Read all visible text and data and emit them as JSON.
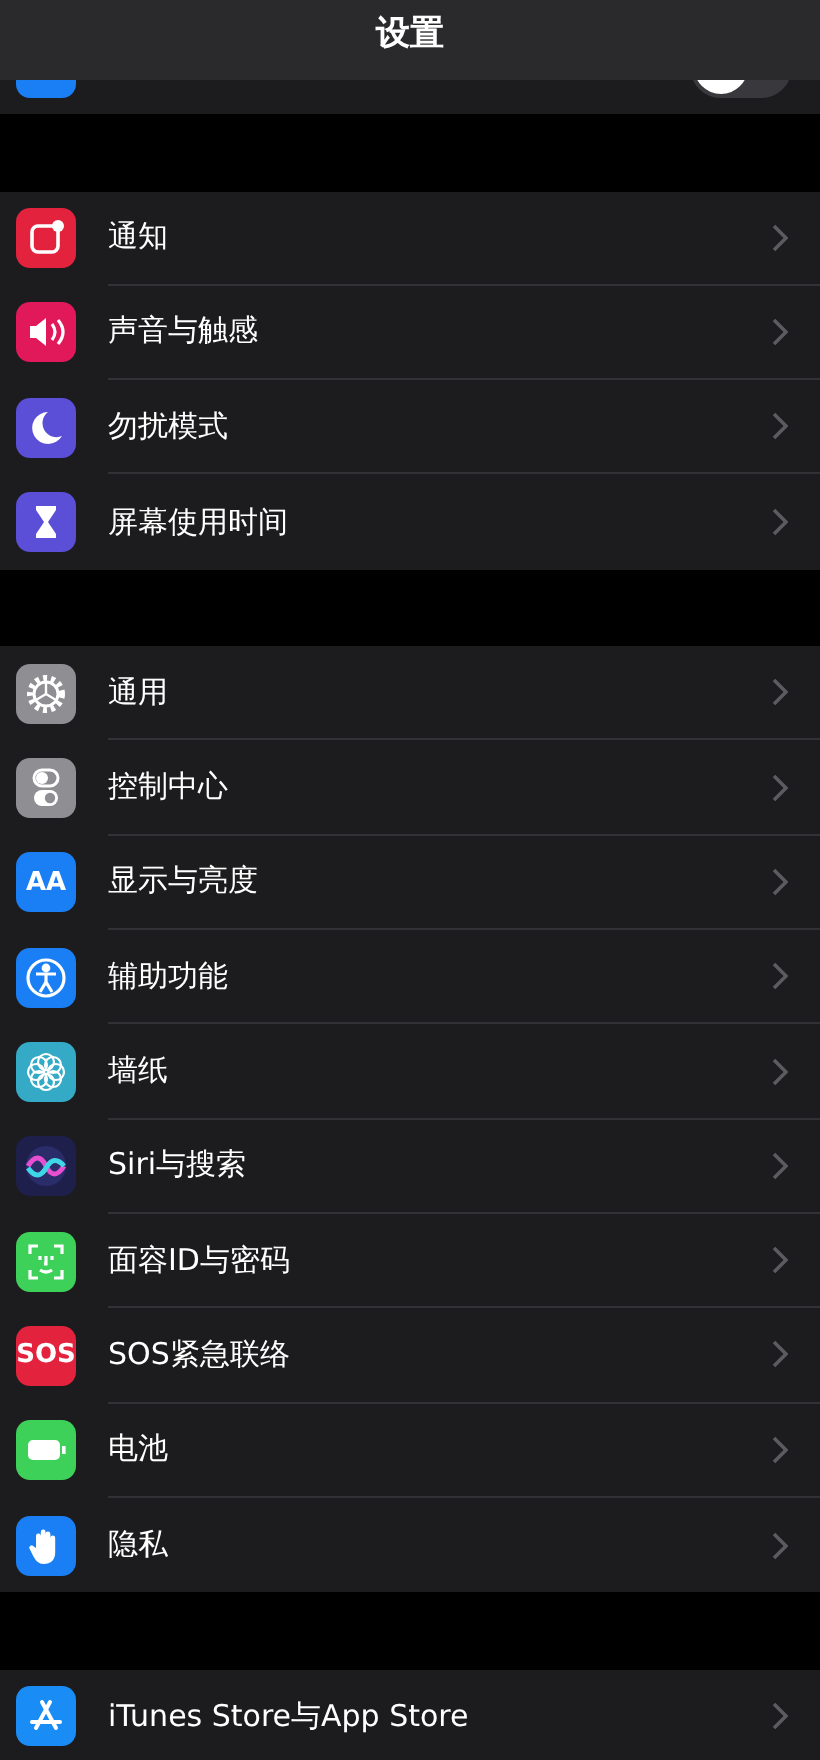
{
  "header": {
    "title": "设置"
  },
  "partial_row": {
    "color": "#1a7ff5",
    "toggle": {
      "on": false
    }
  },
  "sections": [
    {
      "rows": [
        {
          "label": "通知",
          "kind": "notification",
          "color": "#e3223d"
        },
        {
          "label": "声音与触感",
          "kind": "sound",
          "color": "#e1195a"
        },
        {
          "label": "勿扰模式",
          "kind": "moon",
          "color": "#5a4fd6"
        },
        {
          "label": "屏幕使用时间",
          "kind": "hourglass",
          "color": "#5a4fd6"
        }
      ]
    },
    {
      "rows": [
        {
          "label": "通用",
          "kind": "gear",
          "color": "#8e8e93"
        },
        {
          "label": "控制中心",
          "kind": "switches",
          "color": "#8e8e93"
        },
        {
          "label": "显示与亮度",
          "kind": "text",
          "icon_text": "AA",
          "color": "#1a7ff5"
        },
        {
          "label": "辅助功能",
          "kind": "accessibility",
          "color": "#1a7ff5"
        },
        {
          "label": "墙纸",
          "kind": "flower",
          "color": "#35aac6"
        },
        {
          "label": "Siri与搜索",
          "kind": "siri",
          "color": "#1e1f4a"
        },
        {
          "label": "面容ID与密码",
          "kind": "face",
          "color": "#3ed159"
        },
        {
          "label": "SOS紧急联络",
          "kind": "text",
          "icon_text": "SOS",
          "color": "#e3223d"
        },
        {
          "label": "电池",
          "kind": "battery",
          "color": "#3ed159"
        },
        {
          "label": "隐私",
          "kind": "hand",
          "color": "#1a7ff5"
        }
      ]
    },
    {
      "rows": [
        {
          "label": "iTunes Store与App Store",
          "kind": "appstore",
          "color": "#1a8cf5"
        }
      ]
    }
  ]
}
